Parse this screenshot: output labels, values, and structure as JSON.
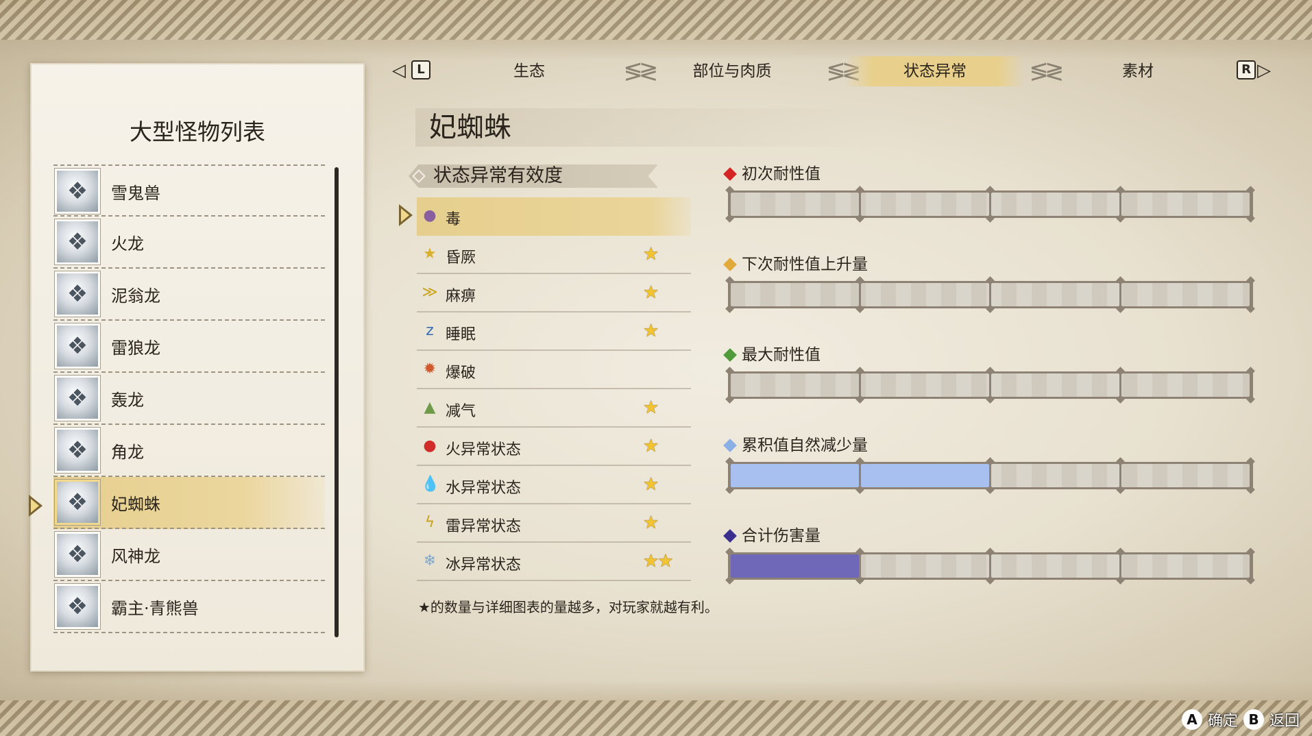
{
  "left_panel": {
    "title": "大型怪物列表",
    "monsters": [
      {
        "name": "雪鬼兽",
        "icon": "monster-portrait"
      },
      {
        "name": "火龙",
        "icon": "monster-portrait"
      },
      {
        "name": "泥翁龙",
        "icon": "monster-portrait"
      },
      {
        "name": "雷狼龙",
        "icon": "monster-portrait"
      },
      {
        "name": "轰龙",
        "icon": "monster-portrait"
      },
      {
        "name": "角龙",
        "icon": "monster-portrait"
      },
      {
        "name": "妃蜘蛛",
        "icon": "monster-portrait",
        "selected": true
      },
      {
        "name": "风神龙",
        "icon": "monster-portrait"
      },
      {
        "name": "霸主·青熊兽",
        "icon": "monster-portrait"
      }
    ]
  },
  "tabs": {
    "left_key": "L",
    "right_key": "R",
    "items": [
      {
        "label": "生态"
      },
      {
        "label": "部位与肉质"
      },
      {
        "label": "状态异常",
        "active": true
      },
      {
        "label": "素材"
      }
    ]
  },
  "monster_title": "妃蜘蛛",
  "effectiveness": {
    "header": "状态异常有效度",
    "rows": [
      {
        "label": "毒",
        "icon": "poison-icon",
        "glyph": "●",
        "color": "#8a5fa0",
        "stars": "",
        "selected": true
      },
      {
        "label": "昏厥",
        "icon": "stun-icon",
        "glyph": "★",
        "color": "#d8b02a",
        "stars": "★"
      },
      {
        "label": "麻痹",
        "icon": "paralysis-icon",
        "glyph": "≫",
        "color": "#c9a319",
        "stars": "★"
      },
      {
        "label": "睡眠",
        "icon": "sleep-icon",
        "glyph": "z",
        "color": "#3a6fb8",
        "stars": "★"
      },
      {
        "label": "爆破",
        "icon": "blast-icon",
        "glyph": "✹",
        "color": "#d0582a",
        "stars": ""
      },
      {
        "label": "减气",
        "icon": "exhaust-icon",
        "glyph": "▲",
        "color": "#6f9a4a",
        "stars": "★"
      },
      {
        "label": "火异常状态",
        "icon": "fire-icon",
        "glyph": "●",
        "color": "#d02c2c",
        "stars": "★"
      },
      {
        "label": "水异常状态",
        "icon": "water-icon",
        "glyph": "💧",
        "color": "#3a8fd8",
        "stars": "★"
      },
      {
        "label": "雷异常状态",
        "icon": "thunder-icon",
        "glyph": "ϟ",
        "color": "#c9a319",
        "stars": "★"
      },
      {
        "label": "冰异常状态",
        "icon": "ice-icon",
        "glyph": "❄",
        "color": "#7fa7c8",
        "stars": "★★"
      }
    ],
    "footnote": "★的数量与详细图表的量越多，对玩家就越有利。"
  },
  "resistance": [
    {
      "label": "初次耐性值",
      "diamond_color": "#d42424",
      "fill_fraction": 0,
      "fill_color": ""
    },
    {
      "label": "下次耐性值上升量",
      "diamond_color": "#e0a93a",
      "fill_fraction": 0,
      "fill_color": ""
    },
    {
      "label": "最大耐性值",
      "diamond_color": "#4f9a3a",
      "fill_fraction": 0,
      "fill_color": ""
    },
    {
      "label": "累积值自然减少量",
      "diamond_color": "#8ab0e6",
      "fill_fraction": 0.5,
      "fill_color": "#a8c0f0"
    },
    {
      "label": "合计伤害量",
      "diamond_color": "#3a2f8f",
      "fill_fraction": 0.25,
      "fill_color": "#6f68b8"
    }
  ],
  "prompts": {
    "confirm_key": "A",
    "confirm_label": "确定",
    "back_key": "B",
    "back_label": "返回"
  }
}
